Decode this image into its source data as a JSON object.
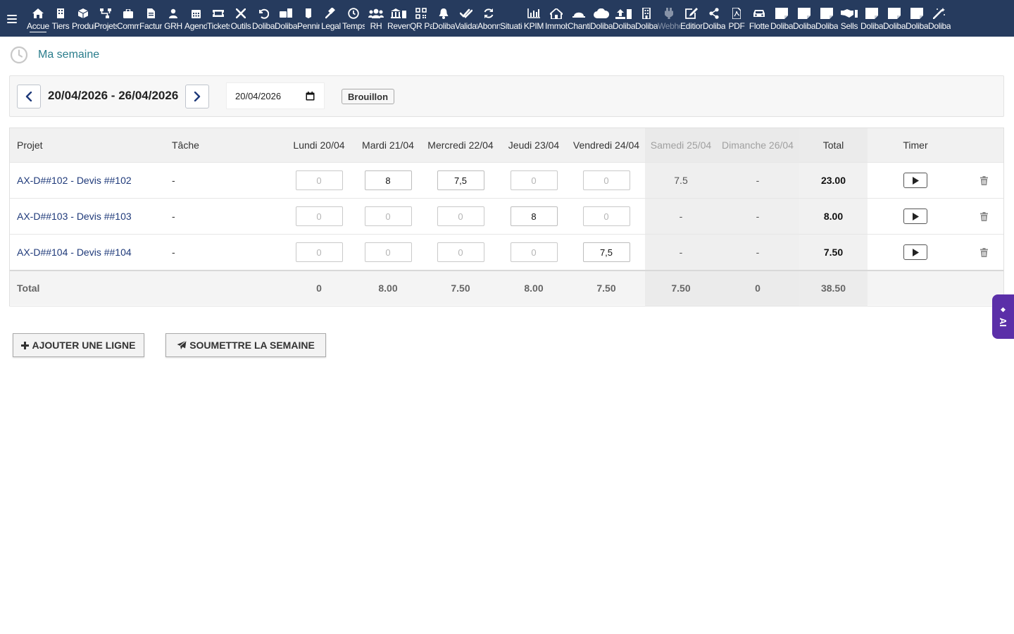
{
  "menu": [
    {
      "label": "Accueil",
      "icon": "home-icon",
      "active": true
    },
    {
      "label": "Tiers",
      "icon": "building-icon"
    },
    {
      "label": "Produits",
      "icon": "cube-icon"
    },
    {
      "label": "Projets",
      "icon": "sitemap-icon"
    },
    {
      "label": "Commercial",
      "icon": "briefcase-icon"
    },
    {
      "label": "Factures",
      "icon": "invoice-icon"
    },
    {
      "label": "GRH",
      "icon": "users-icon"
    },
    {
      "label": "Agenda",
      "icon": "calendar-icon"
    },
    {
      "label": "Tickets",
      "icon": "ticket-icon"
    },
    {
      "label": "Outils",
      "icon": "tools-icon"
    },
    {
      "label": "Dolibarr",
      "icon": "undo-icon"
    },
    {
      "label": "Dolibarr",
      "icon": "case-doc-icon"
    },
    {
      "label": "Penning",
      "icon": "note-icon"
    },
    {
      "label": "Legal",
      "icon": "gavel-icon"
    },
    {
      "label": "Temps",
      "icon": "clock-icon"
    },
    {
      "label": "RH",
      "icon": "group-icon"
    },
    {
      "label": "Revenus",
      "icon": "bank-icon"
    },
    {
      "label": "QR Pay",
      "icon": "qrcode-icon"
    },
    {
      "label": "Dolibarr",
      "icon": "bell-icon"
    },
    {
      "label": "Validation",
      "icon": "double-check-icon"
    },
    {
      "label": "Abonnements",
      "icon": "refresh-icon"
    },
    {
      "label": "Situations",
      "icon": "blank-icon"
    },
    {
      "label": "KPIM",
      "icon": "bar-chart-icon"
    },
    {
      "label": "Immobilier",
      "icon": "house-icon"
    },
    {
      "label": "Chantier",
      "icon": "helmet-icon"
    },
    {
      "label": "Dolibarr",
      "icon": "cloud-icon"
    },
    {
      "label": "Dolibarr",
      "icon": "upload-icon"
    },
    {
      "label": "Dolibarr",
      "icon": "tower-icon"
    },
    {
      "label": "Webhook",
      "icon": "plug-icon",
      "dim": true
    },
    {
      "label": "Editions",
      "icon": "edit-icon"
    },
    {
      "label": "Dolibarr",
      "icon": "share-icon"
    },
    {
      "label": "PDF",
      "icon": "pdf-icon"
    },
    {
      "label": "Flotte",
      "icon": "car-icon"
    },
    {
      "label": "Dolibarr",
      "icon": "sticky-note-icon"
    },
    {
      "label": "Dolibarr",
      "icon": "sticky-note-icon"
    },
    {
      "label": "Dolibarr",
      "icon": "sticky-note-icon"
    },
    {
      "label": "Sells",
      "icon": "handshake-icon"
    },
    {
      "label": "Dolibarr",
      "icon": "sticky-note-icon"
    },
    {
      "label": "Dolibarr",
      "icon": "sticky-note-icon"
    },
    {
      "label": "Dolibarr",
      "icon": "sticky-note-icon"
    },
    {
      "label": "Dolibarr",
      "icon": "magic-wand-icon"
    }
  ],
  "page": {
    "title": "Ma semaine"
  },
  "week": {
    "range": "20/04/2026 - 26/04/2026",
    "date_value": "20/04/2026",
    "status": "Brouillon"
  },
  "table": {
    "headers": {
      "project": "Projet",
      "task": "Tâche",
      "days": [
        "Lundi 20/04",
        "Mardi 21/04",
        "Mercredi 22/04",
        "Jeudi 23/04",
        "Vendredi 24/04",
        "Samedi 25/04",
        "Dimanche 26/04"
      ],
      "total": "Total",
      "timer": "Timer"
    },
    "rows": [
      {
        "project": "AX-D##102 - Devis ##102",
        "task": "-",
        "inputs": [
          "0",
          "8",
          "7,5",
          "0",
          "0"
        ],
        "filled": [
          false,
          true,
          true,
          false,
          false
        ],
        "saturday": "7.5",
        "sunday": "-",
        "total": "23.00"
      },
      {
        "project": "AX-D##103 - Devis ##103",
        "task": "-",
        "inputs": [
          "0",
          "0",
          "0",
          "8",
          "0"
        ],
        "filled": [
          false,
          false,
          false,
          true,
          false
        ],
        "saturday": "-",
        "sunday": "-",
        "total": "8.00"
      },
      {
        "project": "AX-D##104 - Devis ##104",
        "task": "-",
        "inputs": [
          "0",
          "0",
          "0",
          "0",
          "7,5"
        ],
        "filled": [
          false,
          false,
          false,
          false,
          true
        ],
        "saturday": "-",
        "sunday": "-",
        "total": "7.50"
      }
    ],
    "totals": {
      "label": "Total",
      "days": [
        "0",
        "8.00",
        "7.50",
        "8.00",
        "7.50",
        "7.50",
        "0"
      ],
      "grand_total": "38.50"
    }
  },
  "actions": {
    "add_line": "AJOUTER UNE LIGNE",
    "submit_week": "SOUMETTRE LA SEMAINE"
  },
  "ai_tab": {
    "label": "AI"
  },
  "colors": {
    "topbar": "#263b5e",
    "title": "#2a7d8c",
    "project_link": "#1f3a7a",
    "ai_tab": "#5b2fa8"
  }
}
